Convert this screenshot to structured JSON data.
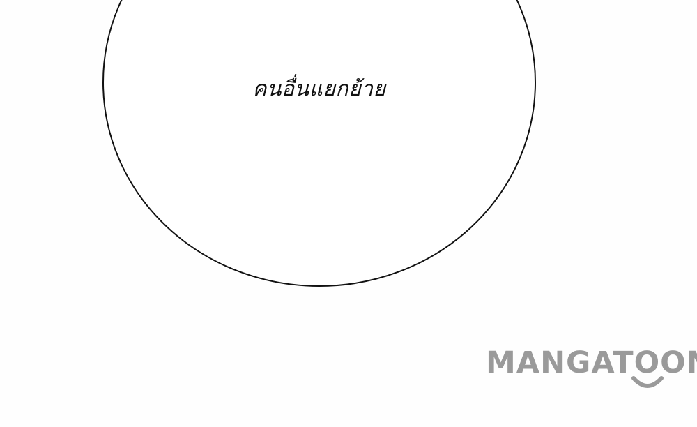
{
  "speech_bubble": {
    "text": "คนอื่นแยกย้าย"
  },
  "watermark": {
    "text": "MANGATOON",
    "color": "#9a9a9a"
  }
}
